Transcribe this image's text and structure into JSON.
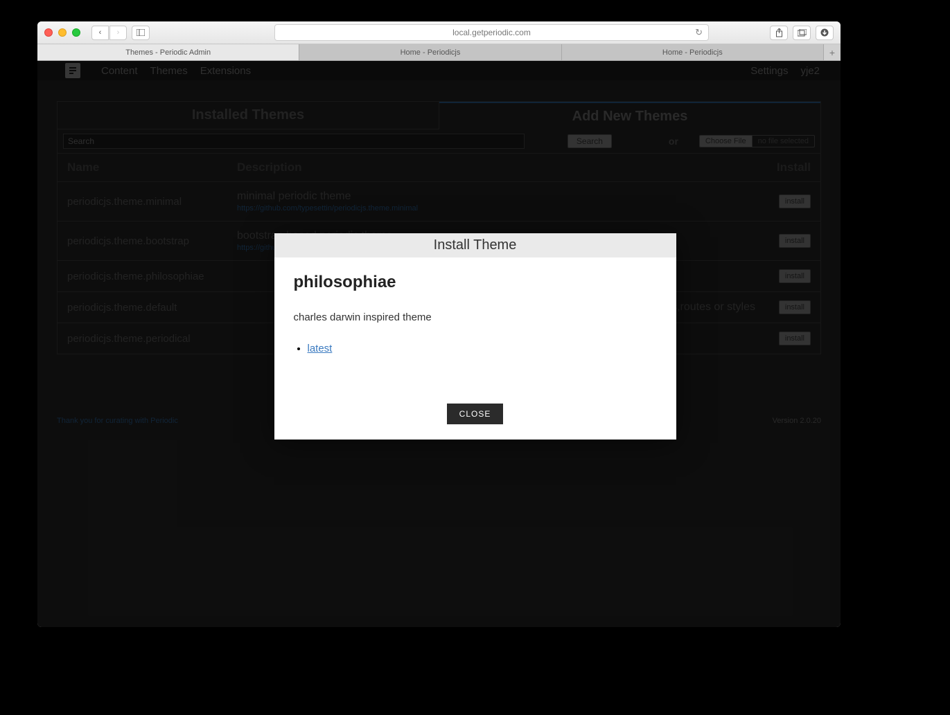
{
  "browser": {
    "url": "local.getperiodic.com",
    "tabs": [
      {
        "label": "Themes - Periodic Admin",
        "active": true
      },
      {
        "label": "Home - Periodicjs",
        "active": false
      },
      {
        "label": "Home - Periodicjs",
        "active": false
      }
    ]
  },
  "nav": {
    "links": [
      "Content",
      "Themes",
      "Extensions"
    ],
    "right": [
      "Settings",
      "yje2"
    ]
  },
  "panel": {
    "tabs": [
      "Installed Themes",
      "Add New Themes"
    ],
    "active_index": 1,
    "search_placeholder": "Search",
    "search_button": "Search",
    "or_label": "or",
    "choose_file": "Choose File",
    "no_file": "no file selected",
    "headers": {
      "name": "Name",
      "description": "Description",
      "install": "Install"
    },
    "install_label": "install",
    "rows": [
      {
        "name": "periodicjs.theme.minimal",
        "desc": "minimal periodic theme",
        "link": "https://github.com/typesettin/periodicjs.theme.minimal"
      },
      {
        "name": "periodicjs.theme.bootstrap",
        "desc": "bootstrap based periodic theme",
        "link": "https://github.com/typesettin/periodicjs.theme.bootstrap"
      },
      {
        "name": "periodicjs.theme.philosophiae",
        "desc": "",
        "link": ""
      },
      {
        "name": "periodicjs.theme.default",
        "desc": "ws,routes or styles",
        "link": ""
      },
      {
        "name": "periodicjs.theme.periodical",
        "desc": "",
        "link": ""
      }
    ]
  },
  "footer": {
    "left": "Thank you for curating with Periodic",
    "right": "Version 2.0.20"
  },
  "modal": {
    "header": "Install Theme",
    "title": "philosophiae",
    "desc": "charles darwin inspired theme",
    "version_link": "latest",
    "close": "CLOSE"
  }
}
